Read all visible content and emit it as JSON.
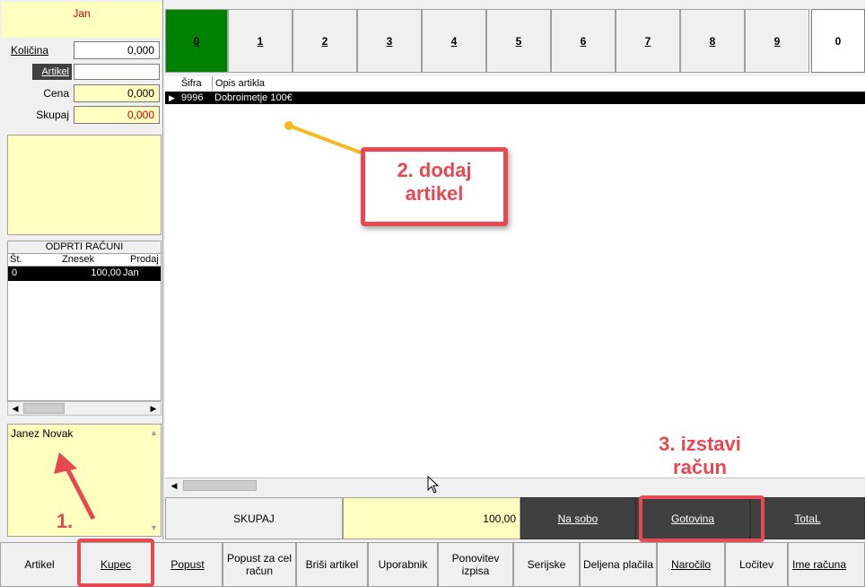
{
  "left_panel": {
    "user": "Jan",
    "fields": [
      {
        "label": "Količina",
        "value": "0,000"
      },
      {
        "label": "Artikel",
        "value": ""
      },
      {
        "label": "Cena",
        "value": "0,000"
      },
      {
        "label": "Skupaj",
        "value": "0,000"
      }
    ],
    "open_bills": {
      "title": "ODPRTI RAČUNI",
      "headers": [
        "Št.",
        "Znesek",
        "Prodaj"
      ],
      "rows": [
        {
          "no": "0",
          "amount": "100,00",
          "seller": "Jan"
        }
      ]
    },
    "customer": "Janez Novak"
  },
  "tabs": [
    "0",
    "1",
    "2",
    "3",
    "4",
    "5",
    "6",
    "7",
    "8",
    "9",
    "0"
  ],
  "grid": {
    "headers": [
      "Šifra",
      "Opis artikla"
    ],
    "rows": [
      {
        "code": "9996",
        "desc": "Dobroimetje 100€"
      }
    ]
  },
  "summary": {
    "label": "SKUPAJ",
    "value": "100,00",
    "buttons": [
      "Na sobo",
      "Gotovina",
      "TotaL"
    ]
  },
  "bottom_buttons": [
    "Artikel",
    "Kupec",
    "Popust",
    "Popust za cel račun",
    "Briši artikel",
    "Uporabnik",
    "Ponovitev izpisa",
    "Serijske",
    "Deljena plačila",
    "Naročilo",
    "Ločitev",
    "Ime računa"
  ],
  "annotations": {
    "step1": "1.",
    "step2": "2. dodaj artikel",
    "step3": "3. izstavi račun"
  },
  "colors": {
    "accent": "#e84850",
    "yellow": "#ffffc0",
    "green": "#008000",
    "dark": "#404040"
  }
}
